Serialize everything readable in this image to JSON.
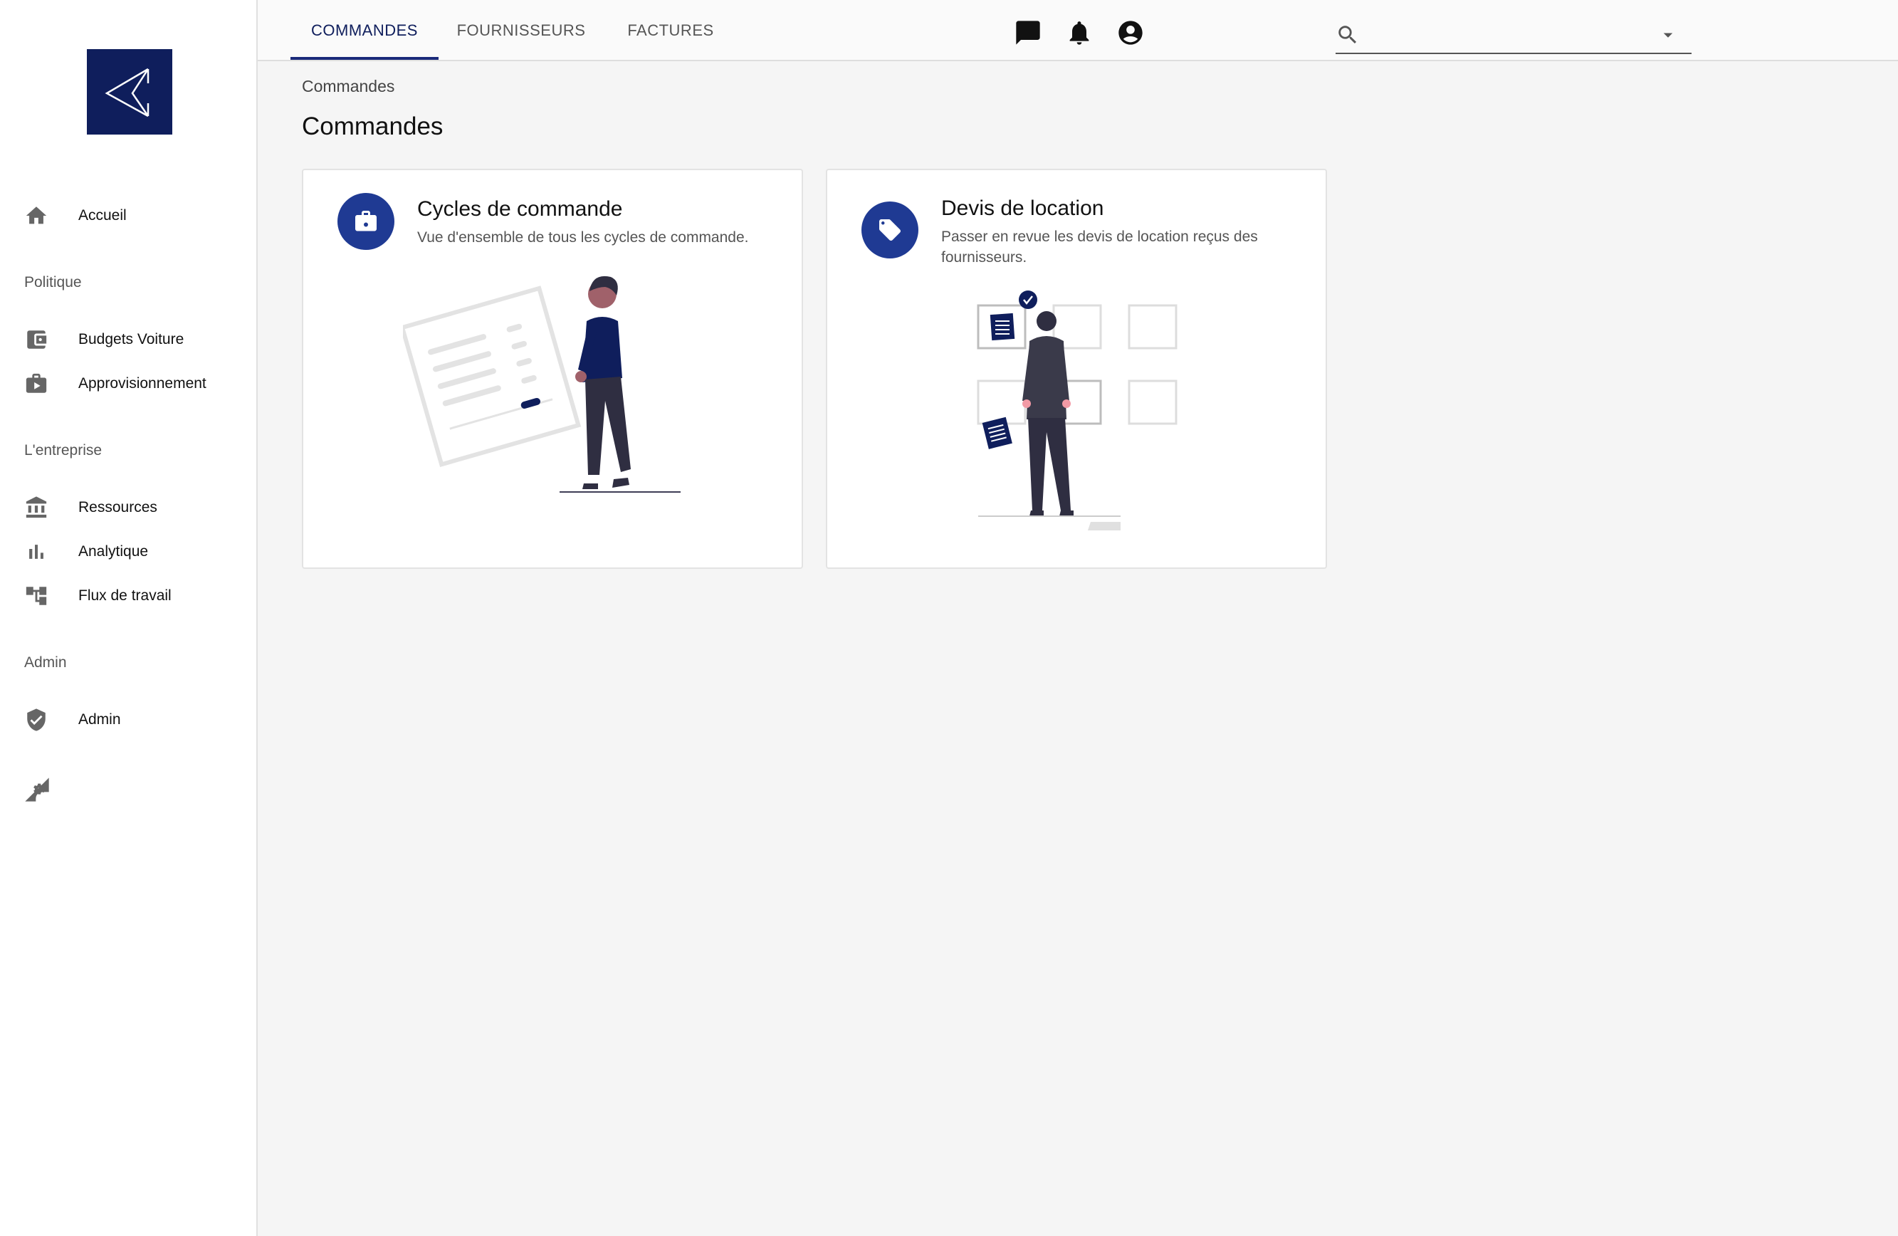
{
  "sidebar": {
    "sections": {
      "politique": "Politique",
      "entreprise": "L'entreprise",
      "admin": "Admin"
    },
    "items": {
      "accueil": {
        "label": "Accueil",
        "icon": "home-icon"
      },
      "budgets": {
        "label": "Budgets Voiture",
        "icon": "wallet-icon"
      },
      "approvisionnement": {
        "label": "Approvisionnement",
        "icon": "briefcase-play-icon"
      },
      "ressources": {
        "label": "Ressources",
        "icon": "bank-icon"
      },
      "analytique": {
        "label": "Analytique",
        "icon": "bar-chart-icon"
      },
      "flux": {
        "label": "Flux de travail",
        "icon": "workflow-icon"
      },
      "admin": {
        "label": "Admin",
        "icon": "shield-check-icon"
      }
    }
  },
  "topbar": {
    "tabs": {
      "commandes": "COMMANDES",
      "fournisseurs": "FOURNISSEURS",
      "factures": "FACTURES"
    },
    "search": {
      "value": "",
      "placeholder": ""
    }
  },
  "main": {
    "breadcrumb": "Commandes",
    "title": "Commandes",
    "cards": {
      "cycles": {
        "title": "Cycles de commande",
        "description": "Vue d'ensemble de tous les cycles de commande."
      },
      "devis": {
        "title": "Devis de location",
        "description": "Passer en revue les devis de location reçus des fournisseurs."
      }
    }
  },
  "colors": {
    "brand": "#0f1e5c",
    "accent": "#1f3a93",
    "sidebar_bg": "#ffffff",
    "page_bg": "#f5f5f5"
  }
}
